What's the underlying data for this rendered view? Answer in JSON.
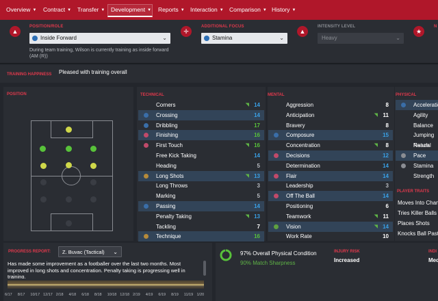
{
  "nav": {
    "items": [
      {
        "label": "Overview"
      },
      {
        "label": "Contract"
      },
      {
        "label": "Transfer"
      },
      {
        "label": "Development"
      },
      {
        "label": "Reports"
      },
      {
        "label": "Interaction"
      },
      {
        "label": "Comparison"
      },
      {
        "label": "History"
      }
    ],
    "active": "Development"
  },
  "filters": {
    "position": {
      "label": "POSITION/ROLE",
      "value": "Inside Forward",
      "note": "During team training, Wilson is currently training as inside forward (AM (R))"
    },
    "focus": {
      "label": "ADDITIONAL FOCUS",
      "value": "Stamina"
    },
    "intensity": {
      "label": "INTENSITY LEVEL",
      "value": "Heavy"
    },
    "fourth": {
      "label": "N"
    }
  },
  "happiness": {
    "label": "TRAINING HAPPINESS",
    "value": "Pleased with training overall"
  },
  "position_panel": {
    "label": "POSITION"
  },
  "technical": {
    "label": "TECHNICAL",
    "rows": [
      {
        "name": "Corners",
        "value": "14",
        "color": "#39a0e6",
        "hl": false,
        "dot": "",
        "arrow": true
      },
      {
        "name": "Crossing",
        "value": "14",
        "color": "#39a0e6",
        "hl": true,
        "dot": "#3a6ea8",
        "arrow": false
      },
      {
        "name": "Dribbling",
        "value": "17",
        "color": "#58c23a",
        "hl": false,
        "dot": "#3a6ea8",
        "arrow": false
      },
      {
        "name": "Finishing",
        "value": "16",
        "color": "#58c23a",
        "hl": true,
        "dot": "#c04a6a",
        "arrow": false
      },
      {
        "name": "First Touch",
        "value": "16",
        "color": "#58c23a",
        "hl": false,
        "dot": "#c04a6a",
        "arrow": true
      },
      {
        "name": "Free Kick Taking",
        "value": "14",
        "color": "#39a0e6",
        "hl": false,
        "dot": "",
        "arrow": false
      },
      {
        "name": "Heading",
        "value": "5",
        "color": "#b9bcc2",
        "hl": false,
        "dot": "",
        "arrow": false
      },
      {
        "name": "Long Shots",
        "value": "13",
        "color": "#39a0e6",
        "hl": true,
        "dot": "#b58a3a",
        "arrow": true
      },
      {
        "name": "Long Throws",
        "value": "3",
        "color": "#b9bcc2",
        "hl": false,
        "dot": "",
        "arrow": false
      },
      {
        "name": "Marking",
        "value": "5",
        "color": "#b9bcc2",
        "hl": false,
        "dot": "",
        "arrow": false
      },
      {
        "name": "Passing",
        "value": "14",
        "color": "#39a0e6",
        "hl": true,
        "dot": "#3a6ea8",
        "arrow": false
      },
      {
        "name": "Penalty Taking",
        "value": "13",
        "color": "#39a0e6",
        "hl": false,
        "dot": "",
        "arrow": true
      },
      {
        "name": "Tackling",
        "value": "7",
        "color": "#fff",
        "hl": false,
        "dot": "",
        "arrow": false
      },
      {
        "name": "Technique",
        "value": "16",
        "color": "#58c23a",
        "hl": true,
        "dot": "#b58a3a",
        "arrow": false
      }
    ]
  },
  "mental": {
    "label": "MENTAL",
    "rows": [
      {
        "name": "Aggression",
        "value": "8",
        "color": "#fff",
        "hl": false,
        "dot": "",
        "arrow": false
      },
      {
        "name": "Anticipation",
        "value": "11",
        "color": "#fff",
        "hl": false,
        "dot": "",
        "arrow": true
      },
      {
        "name": "Bravery",
        "value": "8",
        "color": "#fff",
        "hl": false,
        "dot": "",
        "arrow": false
      },
      {
        "name": "Composure",
        "value": "15",
        "color": "#39a0e6",
        "hl": true,
        "dot": "#3a6ea8",
        "arrow": false
      },
      {
        "name": "Concentration",
        "value": "8",
        "color": "#fff",
        "hl": false,
        "dot": "",
        "arrow": true
      },
      {
        "name": "Decisions",
        "value": "12",
        "color": "#39a0e6",
        "hl": true,
        "dot": "#c04a6a",
        "arrow": false
      },
      {
        "name": "Determination",
        "value": "14",
        "color": "#39a0e6",
        "hl": false,
        "dot": "",
        "arrow": false
      },
      {
        "name": "Flair",
        "value": "14",
        "color": "#39a0e6",
        "hl": true,
        "dot": "#c04a6a",
        "arrow": false
      },
      {
        "name": "Leadership",
        "value": "3",
        "color": "#b9bcc2",
        "hl": false,
        "dot": "",
        "arrow": false
      },
      {
        "name": "Off The Ball",
        "value": "14",
        "color": "#39a0e6",
        "hl": true,
        "dot": "#c04a6a",
        "arrow": false
      },
      {
        "name": "Positioning",
        "value": "6",
        "color": "#fff",
        "hl": false,
        "dot": "",
        "arrow": false
      },
      {
        "name": "Teamwork",
        "value": "11",
        "color": "#fff",
        "hl": false,
        "dot": "",
        "arrow": true
      },
      {
        "name": "Vision",
        "value": "14",
        "color": "#39a0e6",
        "hl": true,
        "dot": "#5fa040",
        "arrow": true
      },
      {
        "name": "Work Rate",
        "value": "10",
        "color": "#fff",
        "hl": false,
        "dot": "",
        "arrow": false
      }
    ]
  },
  "physical": {
    "label": "PHYSICAL",
    "rows": [
      {
        "name": "Acceleration",
        "value": "",
        "hl": true,
        "dot": "#3a6ea8"
      },
      {
        "name": "Agility",
        "value": "",
        "hl": false,
        "dot": ""
      },
      {
        "name": "Balance",
        "value": "",
        "hl": false,
        "dot": ""
      },
      {
        "name": "Jumping Reach",
        "value": "",
        "hl": false,
        "dot": ""
      },
      {
        "name": "Natural Fitness",
        "value": "",
        "hl": false,
        "dot": ""
      },
      {
        "name": "Pace",
        "value": "",
        "hl": true,
        "dot": "#8a8d93"
      },
      {
        "name": "Stamina",
        "value": "",
        "hl": false,
        "dot": "#8a8d93"
      },
      {
        "name": "Strength",
        "value": "",
        "hl": false,
        "dot": ""
      }
    ]
  },
  "traits": {
    "label": "PLAYER TRAITS",
    "items": [
      "Moves Into Channels",
      "Tries Killer Balls Often",
      "Places Shots",
      "Knocks Ball Past Opponent"
    ]
  },
  "progress": {
    "label": "PROGRESS REPORT:",
    "coach": "Z. Buvac (Tactical)",
    "text": "Has made some improvement as a footballer over the last two months. Most improved in long shots and concentration. Penalty taking is progressing well in training.",
    "dates": [
      "6/17",
      "8/17",
      "10/17",
      "12/17",
      "2/18",
      "4/18",
      "6/18",
      "8/18",
      "10/18",
      "12/18",
      "2/19",
      "4/19",
      "6/19",
      "8/19",
      "11/19",
      "1/20"
    ]
  },
  "condition": {
    "physical": "97% Overall Physical Condition",
    "sharpness": "90% Match Sharpness",
    "condition_level": 0.97
  },
  "injury": {
    "label": "INJURY RISK",
    "value": "Increased"
  },
  "individual": {
    "label": "INDI",
    "value": "Med"
  },
  "icons": {
    "position": "position-icon",
    "focus": "crosshair-icon",
    "intensity": "flame-icon",
    "fourth": "star-icon"
  }
}
